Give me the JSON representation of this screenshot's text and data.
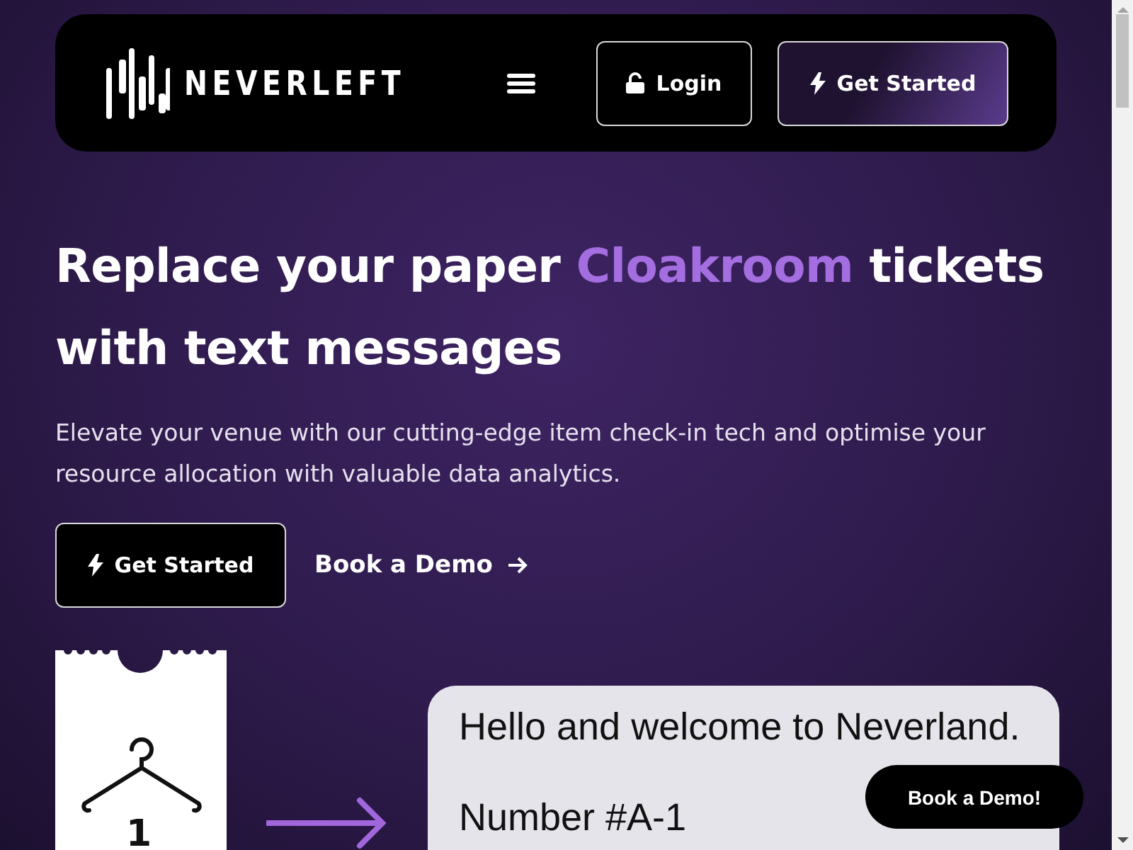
{
  "header": {
    "logo": "NEVERLEFT",
    "login": "Login",
    "get_started": "Get Started"
  },
  "hero": {
    "title_parts": [
      "Replace your paper ",
      "Cloakroom",
      " tickets with text messages"
    ],
    "subtitle": "Elevate your venue with our cutting-edge item check-in tech and optimise your resource allocation with valuable data analytics.",
    "primary_button": "Get Started",
    "secondary_link": "Book a Demo"
  },
  "ticket": {
    "number": "1"
  },
  "message": {
    "lines": [
      "Hello and welcome to Neverland.",
      "Number #A-1"
    ]
  },
  "floating_button": "Book a Demo!"
}
